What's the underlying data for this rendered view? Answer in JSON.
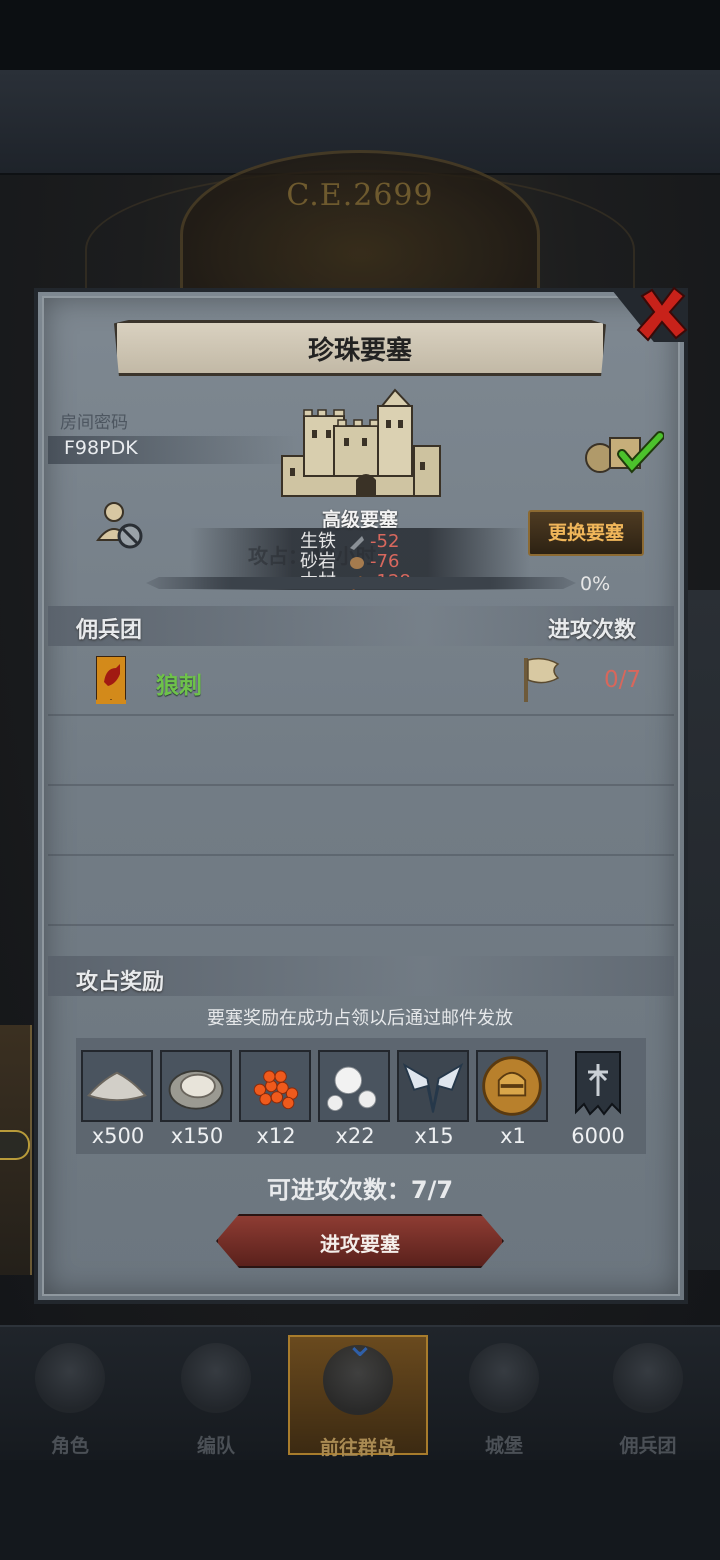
{
  "background": {
    "era_text": "C.E.2699"
  },
  "bottom_nav": {
    "items": [
      {
        "label": "角色"
      },
      {
        "label": "编队"
      },
      {
        "label": "前往群岛"
      },
      {
        "label": "城堡"
      },
      {
        "label": "佣兵团"
      }
    ],
    "active": "前往群岛"
  },
  "modal": {
    "title": "珍珠要塞",
    "room_label": "房间密码",
    "room_code": "F98PDK",
    "fortress_level": "高级要塞",
    "occupy_ghost": "攻占：40小时",
    "resources": [
      {
        "name": "生铁",
        "value": "-52",
        "icon": "iron-icon"
      },
      {
        "name": "砂岩",
        "value": "-76",
        "icon": "sandstone-icon"
      },
      {
        "name": "木材",
        "value": "-128",
        "icon": "wood-icon"
      }
    ],
    "swap_button": "更换要塞",
    "progress": {
      "percent_label": "0%",
      "value": 0
    },
    "mercenary_section": {
      "title": "佣兵团",
      "attack_header": "进攻次数",
      "entries": [
        {
          "name": "狼刺",
          "attacks": "0/7"
        }
      ]
    },
    "reward_section": {
      "title": "攻占奖励",
      "note": "要塞奖励在成功占领以后通过邮件发放",
      "items": [
        {
          "icon": "salt-icon",
          "qty": "x500"
        },
        {
          "icon": "oyster-icon",
          "qty": "x150"
        },
        {
          "icon": "fish-roe-icon",
          "qty": "x12"
        },
        {
          "icon": "pearl-icon",
          "qty": "x22"
        },
        {
          "icon": "winged-emblem-icon",
          "qty": "x15"
        },
        {
          "icon": "knight-helmet-coin-icon",
          "qty": "x1"
        },
        {
          "icon": "banner-icon",
          "qty": "6000"
        }
      ]
    },
    "attack_times": "可进攻次数：7/7",
    "attack_button": "进攻要塞"
  },
  "colors": {
    "panel": "#7b858e",
    "accent_gold": "#f0b65a",
    "attack_red": "#8e3c33",
    "mercenary_green": "#6ec24a",
    "negative_red": "#d9685e"
  }
}
